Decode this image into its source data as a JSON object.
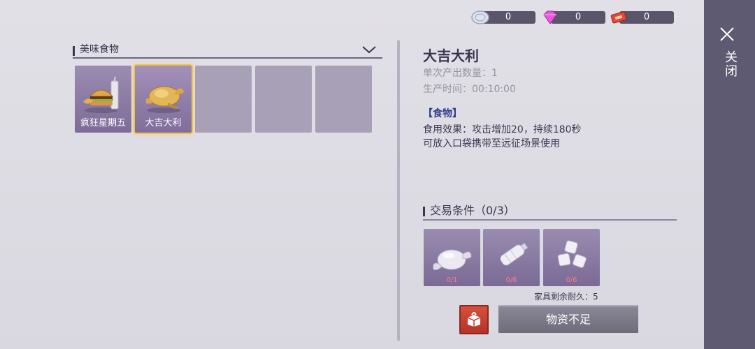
{
  "currencies": [
    {
      "icon": "coin-icon",
      "value": "0"
    },
    {
      "icon": "diamond-icon",
      "value": "0"
    },
    {
      "icon": "ticket-icon",
      "value": "0"
    }
  ],
  "category": {
    "title": "美味食物"
  },
  "slots": [
    {
      "label": "疯狂星期五",
      "icon": "burger-meal-icon"
    },
    {
      "label": "大吉大利",
      "icon": "roast-chicken-icon"
    }
  ],
  "detail": {
    "title": "大吉大利",
    "output_qty": "单次产出数量：1",
    "production_time": "生产时间：00:10:00",
    "tag": "【食物】",
    "effect": "食用效果：攻击增加20，持续180秒",
    "usage": "可放入口袋携带至远征场景使用"
  },
  "trade": {
    "title": "交易条件（0/3）",
    "requirements": [
      {
        "icon": "raw-chicken-icon",
        "count": "0/1"
      },
      {
        "icon": "water-bottle-icon",
        "count": "0/6"
      },
      {
        "icon": "ice-cubes-icon",
        "count": "0/6"
      }
    ],
    "durability": "家具剩余耐久：5",
    "action_label": "物资不足"
  },
  "close": {
    "label": "关闭"
  }
}
